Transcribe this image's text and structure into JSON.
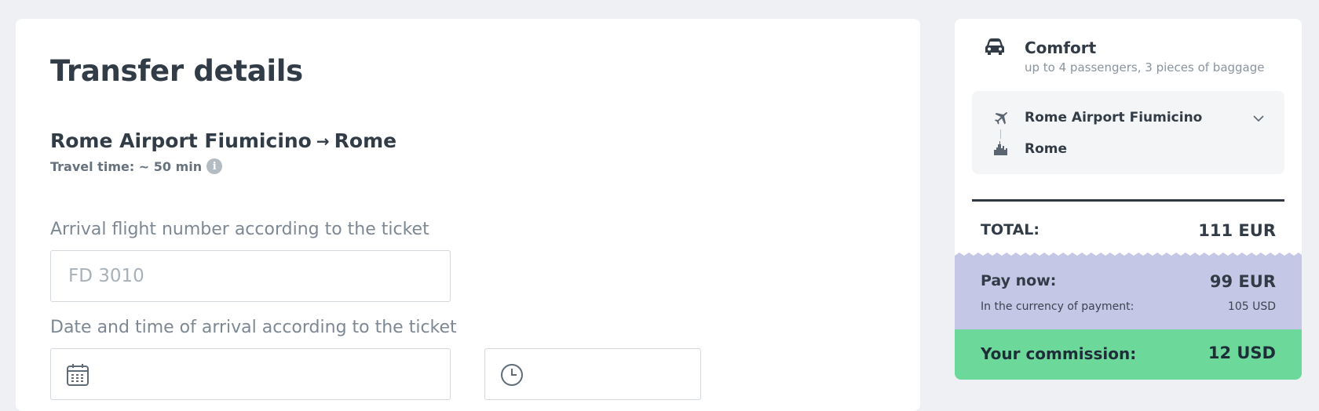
{
  "page": {
    "title": "Transfer details"
  },
  "route": {
    "from": "Rome Airport Fiumicino",
    "arrow": "→",
    "to": "Rome"
  },
  "travel_time": "Travel time: ~ 50 min",
  "flight": {
    "label": "Arrival flight number according to the ticket",
    "placeholder": "FD 3010",
    "value": ""
  },
  "arrival": {
    "label": "Date and time of arrival according to the ticket",
    "date_value": "",
    "time_value": ""
  },
  "summary": {
    "vehicle_class": "Comfort",
    "vehicle_desc": "up to 4 passengers, 3 pieces of baggage",
    "from": "Rome Airport Fiumicino",
    "to": "Rome",
    "total_label": "TOTAL:",
    "total_value": "111 EUR",
    "pay_now_label": "Pay now:",
    "pay_now_value": "99 EUR",
    "currency_label": "In the currency of payment:",
    "currency_value": "105 USD",
    "commission_label": "Your commission:",
    "commission_value": "12 USD"
  },
  "icons": {
    "info": "info-icon",
    "calendar": "calendar-icon",
    "clock": "clock-icon",
    "car": "car-icon",
    "plane": "plane-icon",
    "city": "city-icon",
    "chevron": "chevron-down-icon"
  },
  "colors": {
    "pay_now_bg": "#c5c7e6",
    "commission_bg": "#6cd89a",
    "page_bg": "#eef0f3"
  }
}
